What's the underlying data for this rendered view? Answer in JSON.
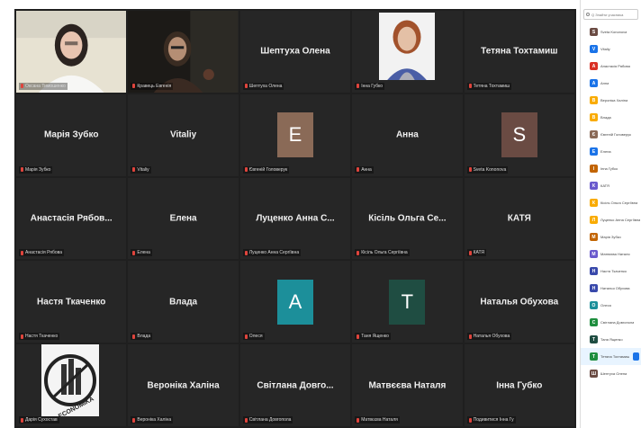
{
  "meeting": {
    "tiles": [
      {
        "type": "video",
        "label": "Оксана Тимошенко",
        "active": true
      },
      {
        "type": "video",
        "label": "Кравець Евгенія"
      },
      {
        "type": "name",
        "name": "Шептуха Олена",
        "label": "Шептуха Олена"
      },
      {
        "type": "video",
        "label": "Інна Губко"
      },
      {
        "type": "name",
        "name": "Тетяна Тохтамиш",
        "label": "Тетяна Тохтамиш"
      },
      {
        "type": "name",
        "name": "Марія Зубко",
        "label": "Марія Зубко"
      },
      {
        "type": "name",
        "name": "Vitaliy",
        "label": "Vitaliy"
      },
      {
        "type": "letter",
        "letter": "E",
        "color": "#8a6a57",
        "label": "Євгеній Головерук"
      },
      {
        "type": "name",
        "name": "Анна",
        "label": "Анна"
      },
      {
        "type": "letter",
        "letter": "S",
        "color": "#6a4b43",
        "label": "Sveta Kononova"
      },
      {
        "type": "name",
        "name": "Анастасія Рябов...",
        "label": "Анастасія Рябова"
      },
      {
        "type": "name",
        "name": "Елена",
        "label": "Елена"
      },
      {
        "type": "name",
        "name": "Луценко Анна С...",
        "label": "Луценко Анна Сергіївна"
      },
      {
        "type": "name",
        "name": "Кісіль Ольга Се...",
        "label": "Кісіль Ольга Сергіївна"
      },
      {
        "type": "name",
        "name": "КАТЯ",
        "label": "КАТЯ"
      },
      {
        "type": "name",
        "name": "Настя Ткаченко",
        "label": "Настя Ткаченко"
      },
      {
        "type": "name",
        "name": "Влада",
        "label": "Влада"
      },
      {
        "type": "letter",
        "letter": "A",
        "color": "#1c8f9a",
        "label": "Олеся"
      },
      {
        "type": "letter",
        "letter": "T",
        "color": "#1f4d42",
        "label": "Таня Ященко"
      },
      {
        "type": "name",
        "name": "Наталья Обухова",
        "label": "Наталья Обухова"
      },
      {
        "type": "logo",
        "logo_text": "ECONOMIKA",
        "label": "Дарія Сухостав"
      },
      {
        "type": "name",
        "name": "Вероніка Халіна",
        "label": "Вероніка Халіна"
      },
      {
        "type": "name",
        "name": "Світлана Довго...",
        "label": "Світлана Довгопола"
      },
      {
        "type": "name",
        "name": "Матвєєва Наталя",
        "label": "Матвєєва Наталя"
      },
      {
        "type": "name",
        "name": "Інна Губко",
        "label": "Подивитися Інна Гу"
      }
    ]
  },
  "sidebar": {
    "search_placeholder": "Q Знайти учасника",
    "participants": [
      {
        "initial": "S",
        "color": "#6a4b43",
        "name": "Sveta Kononova"
      },
      {
        "initial": "V",
        "color": "#1a73e8",
        "name": "Vitaliy"
      },
      {
        "initial": "А",
        "color": "#d93025",
        "name": "Анастасія Рябова"
      },
      {
        "initial": "А",
        "color": "#1a73e8",
        "name": "Анна"
      },
      {
        "initial": "В",
        "color": "#f9ab00",
        "name": "Вероніка Халіна"
      },
      {
        "initial": "В",
        "color": "#f9ab00",
        "name": "Влада"
      },
      {
        "initial": "Є",
        "color": "#8a6a57",
        "name": "Євгеній Головерук"
      },
      {
        "initial": "Е",
        "color": "#1a73e8",
        "name": "Елена"
      },
      {
        "initial": "І",
        "color": "#c26401",
        "name": "Інна Губко"
      },
      {
        "initial": "К",
        "color": "#6a5acd",
        "name": "КАТЯ"
      },
      {
        "initial": "К",
        "color": "#f9ab00",
        "name": "Кісіль Ольга Сергіївна"
      },
      {
        "initial": "Л",
        "color": "#f9ab00",
        "name": "Луценко Анна Сергіївна"
      },
      {
        "initial": "М",
        "color": "#c26401",
        "name": "Марія Зубко"
      },
      {
        "initial": "М",
        "color": "#6a5acd",
        "name": "Матвєєва Наталя"
      },
      {
        "initial": "Н",
        "color": "#3949ab",
        "name": "Настя Ткаченко"
      },
      {
        "initial": "Н",
        "color": "#3949ab",
        "name": "Наталья Обухова"
      },
      {
        "initial": "О",
        "color": "#1c8f9a",
        "name": "Олеся"
      },
      {
        "initial": "С",
        "color": "#1e8e3e",
        "name": "Світлана Довгопола"
      },
      {
        "initial": "Т",
        "color": "#1f4d42",
        "name": "Таня Ященко"
      },
      {
        "initial": "Т",
        "color": "#1e8e3e",
        "name": "Тетяна Тохтамиш",
        "highlight": true
      },
      {
        "initial": "Ш",
        "color": "#6a4b43",
        "name": "Шептуха Олена"
      }
    ]
  }
}
